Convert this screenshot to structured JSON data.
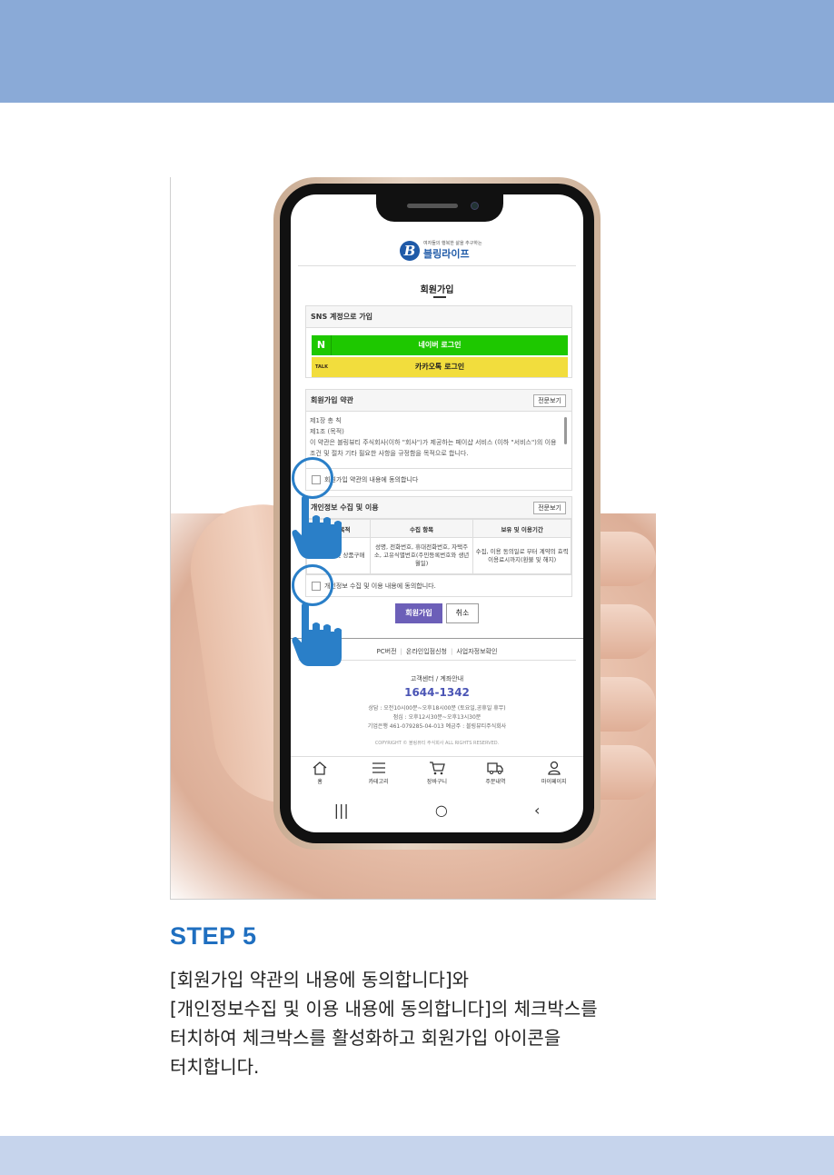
{
  "colors": {
    "top_band": "#8aaad7",
    "bottom_band": "#c6d4ec",
    "step_title": "#1f6fc0",
    "naver": "#1ec800",
    "kakao": "#f2dd3d",
    "join_button": "#6c5fb8",
    "tap_indicator": "#2a7fc8"
  },
  "phone": {
    "logo": {
      "mark": "B",
      "tagline": "여자들의 행복한 삶을 추구하는",
      "name": "블링라이프"
    },
    "page_title": "회원가입",
    "sns": {
      "header": "SNS 계정으로 가입",
      "naver_badge": "N",
      "naver_label": "네이버 로그인",
      "kakao_badge": "TALK",
      "kakao_label": "카카오톡 로그인"
    },
    "terms": {
      "header": "회원가입 약관",
      "view_all": "전문보기",
      "lines": [
        "제1장 총 칙",
        "제1조 (목적)",
        "이 약관은 블링뷰티 주식회사(이하 \"회사\")가 제공하는 페이샵 서비스 (이하 \"서비스\")의 이용조건 및 절차 기타 필요한 사항을 규정함을 목적으로 합니다."
      ],
      "agree_label": "회원가입 약관의 내용에 동의합니다"
    },
    "privacy": {
      "header": "개인정보 수집 및 이용",
      "view_all": "전문보기",
      "columns": [
        "수집 목적",
        "수집 항목",
        "보유 및 이용기간"
      ],
      "row": [
        "회원가입 및 상품구매",
        "성명, 전화번호, 휴대전화번호, 자택주소, 고유식별번호(주민등록번호와 생년월일)",
        "수집, 이용 동의일로 부터 계약의 효력이용료시까지(환불 및 해지)"
      ],
      "agree_label": "개인정보 수집 및 이용 내용에 동의합니다."
    },
    "join_button": "회원가입",
    "cancel_button": "취소",
    "footer_links": [
      "PC버전",
      "온라인입점신청",
      "사업자정보확인"
    ],
    "cs_title": "고객센터 / 계좌안내",
    "cs_phone": "1644-1342",
    "cs_lines": [
      "상담 : 오전10시00분~오후18시00분 (토요일,공휴일 휴무)",
      "점심 : 오후12시30분~오후13시30분",
      "기업은행 461-079285-04-013 예금주 : 블링뷰티주식회사"
    ],
    "copyright": "COPYRIGHT © 블링뷰티 주식회사 ALL RIGHTS RESERVED.",
    "nav": [
      {
        "label": "홈",
        "icon": "home-icon"
      },
      {
        "label": "카테고리",
        "icon": "menu-icon"
      },
      {
        "label": "장바구니",
        "icon": "cart-icon"
      },
      {
        "label": "주문내역",
        "icon": "truck-icon"
      },
      {
        "label": "마이페이지",
        "icon": "user-icon"
      }
    ],
    "system_nav": {
      "recent": "|||",
      "home": "○",
      "back": "‹"
    }
  },
  "step": {
    "title": "STEP 5",
    "lines": [
      "[회원가입 약관의 내용에 동의합니다]와",
      "[개인정보수집 및 이용 내용에 동의합니다]의 체크박스를",
      "터치하여 체크박스를 활성화하고 회원가입 아이콘을",
      "터치합니다."
    ]
  }
}
